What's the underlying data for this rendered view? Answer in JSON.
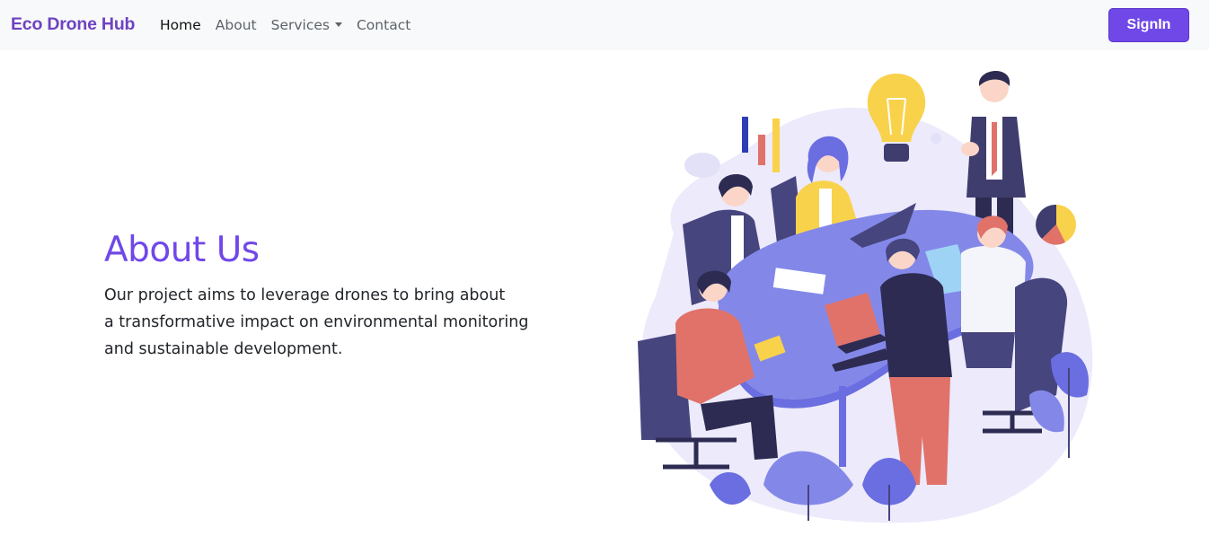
{
  "navbar": {
    "brand": "Eco Drone Hub",
    "links": [
      {
        "label": "Home",
        "active": true
      },
      {
        "label": "About",
        "active": false
      },
      {
        "label": "Services",
        "active": false,
        "dropdown": true
      },
      {
        "label": "Contact",
        "active": false
      }
    ],
    "signin_label": "SignIn"
  },
  "hero": {
    "title": "About Us",
    "lines": [
      "Our project aims to leverage drones to bring about",
      "a transformative impact on environmental monitoring",
      "and sustainable development."
    ]
  },
  "colors": {
    "brand": "#6f42c1",
    "accent": "#7048e8",
    "navbar_bg": "#f8f9fa",
    "illustration_table": "#8388e8",
    "illustration_dark": "#3f3d6e",
    "illustration_yellow": "#f9d24b",
    "illustration_coral": "#e0726a"
  },
  "illustration": {
    "icon": "team-meeting-illustration"
  }
}
